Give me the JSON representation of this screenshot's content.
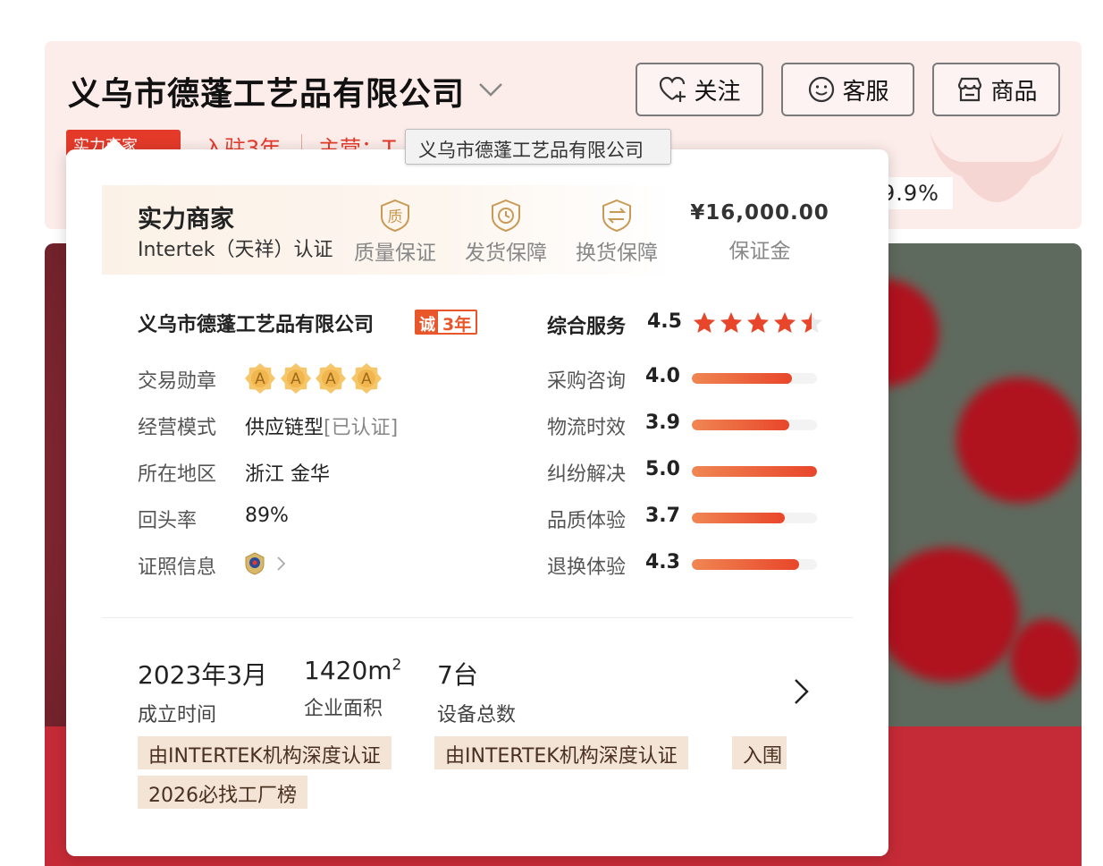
{
  "header": {
    "shop_name": "义乌市德蓬工艺品有限公司",
    "follow_label": "关注",
    "service_label": "客服",
    "goods_label": "商品",
    "badge_strength": "实力商家",
    "joined": "入驻3年",
    "main_business": "主营：T",
    "rate_partial": "9.9%"
  },
  "tooltip": {
    "text": "义乌市德蓬工艺品有限公司"
  },
  "card": {
    "strength_title": "实力商家",
    "strength_sub": "Intertek（天祥）认证",
    "guarantees": [
      {
        "icon": "quality-icon",
        "label": "质量保证"
      },
      {
        "icon": "delivery-icon",
        "label": "发货保障"
      },
      {
        "icon": "exchange-icon",
        "label": "换货保障"
      }
    ],
    "deposit_amount": "¥16,000.00",
    "deposit_label": "保证金",
    "company_name": "义乌市德蓬工艺品有限公司",
    "cheng_char": "诚",
    "cheng_years": "3年",
    "info": {
      "medal_label": "交易勋章",
      "medal_letter": "A",
      "medal_count": 4,
      "mode_label": "经营模式",
      "mode_value": "供应链型",
      "mode_verified": "[已认证]",
      "region_label": "所在地区",
      "region_value": "浙江 金华",
      "repeat_label": "回头率",
      "repeat_value": "89%",
      "license_label": "证照信息"
    },
    "overall": {
      "label": "综合服务",
      "score": "4.5",
      "stars": 4.5
    },
    "metrics": [
      {
        "label": "采购咨询",
        "score": "4.0",
        "fill": 0.8
      },
      {
        "label": "物流时效",
        "score": "3.9",
        "fill": 0.78
      },
      {
        "label": "纠纷解决",
        "score": "5.0",
        "fill": 1.0
      },
      {
        "label": "品质体验",
        "score": "3.7",
        "fill": 0.74
      },
      {
        "label": "退换体验",
        "score": "4.3",
        "fill": 0.86
      }
    ],
    "facts": [
      {
        "value": "2023年3月",
        "label": "成立时间"
      },
      {
        "value": "1420m",
        "sup": "2",
        "label": "企业面积"
      },
      {
        "value": "7台",
        "label": "设备总数"
      }
    ],
    "cert_tags": [
      "由INTERTEK机构深度认证",
      "由INTERTEK机构深度认证",
      "入围",
      "2026必找工厂榜"
    ]
  },
  "colors": {
    "accent": "#e8462a",
    "brand_red": "#e33a2a",
    "gold": "#c99a55",
    "header_bg": "#fcecea",
    "tag_bg": "#f3e4d5"
  }
}
